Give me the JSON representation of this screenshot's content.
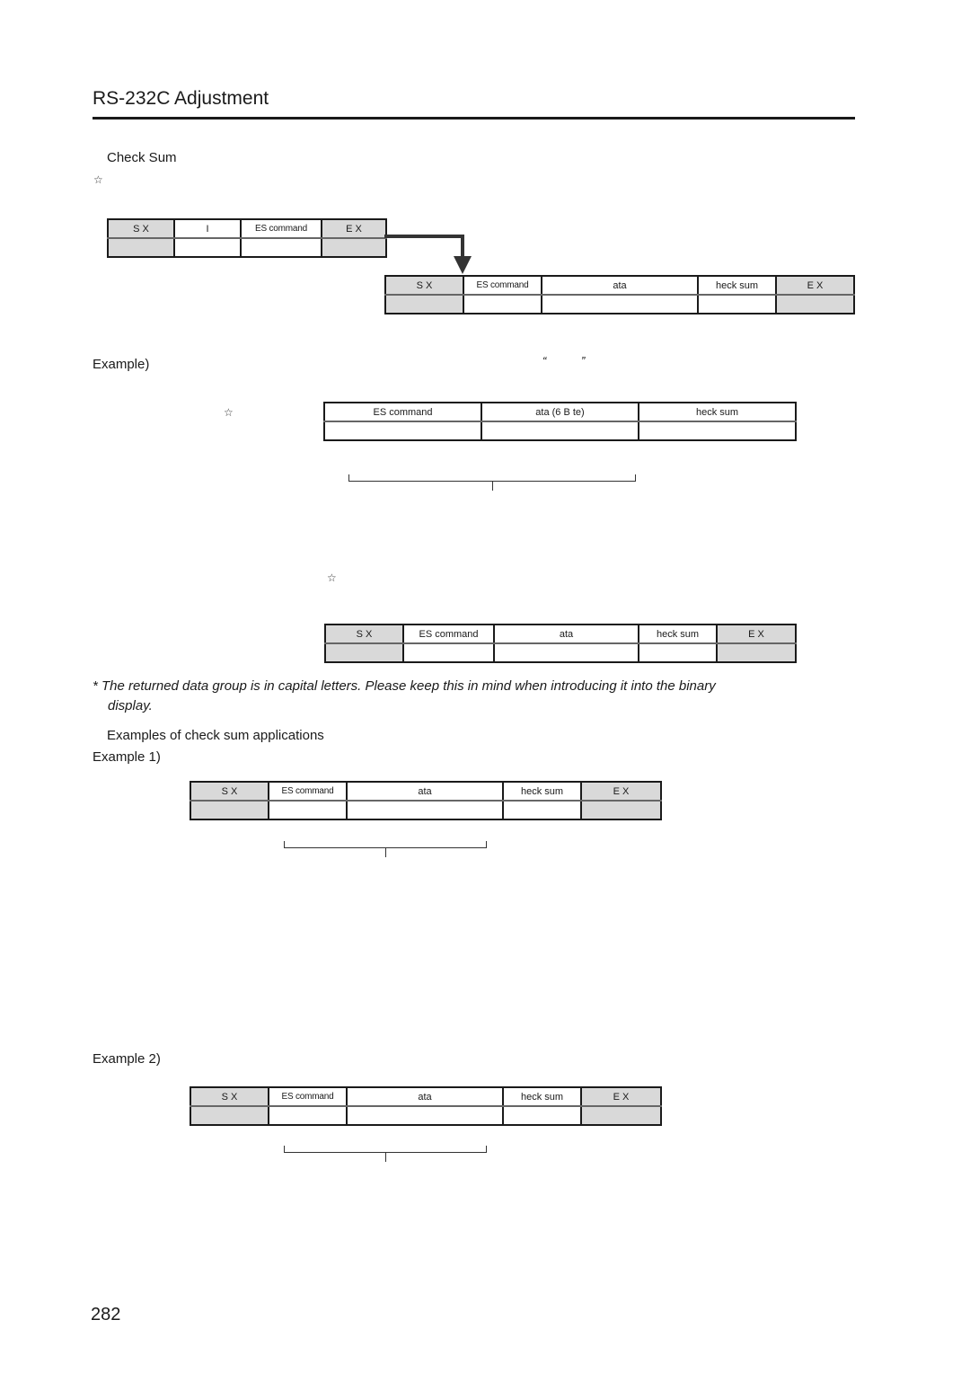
{
  "header": {
    "title": "RS-232C Adjustment"
  },
  "section_check_sum": {
    "heading": "Check Sum",
    "star_icon": "☆",
    "request_frame": {
      "cells": [
        {
          "label": "S X",
          "shaded": true
        },
        {
          "label": "I",
          "shaded": false
        },
        {
          "label": "ES  command",
          "shaded": false
        },
        {
          "label": "E X",
          "shaded": true
        }
      ]
    },
    "response_frame": {
      "cells": [
        {
          "label": "S X",
          "shaded": true
        },
        {
          "label": "ES  command",
          "shaded": false
        },
        {
          "label": "ata",
          "shaded": false
        },
        {
          "label": "heck sum",
          "shaded": false
        },
        {
          "label": "E X",
          "shaded": true
        }
      ]
    }
  },
  "example": {
    "label": "Example)",
    "quote_open": "“",
    "quote_close": "”",
    "star_icon": "☆",
    "calc_frame": {
      "cells": [
        {
          "label": "ES   command"
        },
        {
          "label": "ata (6 B  te)"
        },
        {
          "label": "heck sum"
        }
      ]
    },
    "star_icon_2": "☆",
    "result_frame": {
      "cells": [
        {
          "label": "S X",
          "shaded": true
        },
        {
          "label": "ES   command",
          "shaded": false
        },
        {
          "label": "ata",
          "shaded": false
        },
        {
          "label": "heck sum",
          "shaded": false
        },
        {
          "label": "E X",
          "shaded": true
        }
      ]
    }
  },
  "note": {
    "line1": "* The returned data group is in capital letters. Please keep this in mind when introducing it into the binary",
    "line2": "display."
  },
  "applications": {
    "heading": "Examples of check sum applications",
    "example1": {
      "label": "Example 1)",
      "frame": {
        "cells": [
          {
            "label": "S X",
            "shaded": true
          },
          {
            "label": "ES  command",
            "shaded": false
          },
          {
            "label": "ata",
            "shaded": false
          },
          {
            "label": "heck sum",
            "shaded": false
          },
          {
            "label": "E X",
            "shaded": true
          }
        ]
      }
    },
    "example2": {
      "label": "Example 2)",
      "frame": {
        "cells": [
          {
            "label": "S X",
            "shaded": true
          },
          {
            "label": "ES  command",
            "shaded": false
          },
          {
            "label": "ata",
            "shaded": false
          },
          {
            "label": "heck sum",
            "shaded": false
          },
          {
            "label": "E X",
            "shaded": true
          }
        ]
      }
    }
  },
  "footer": {
    "page_number": "282"
  }
}
